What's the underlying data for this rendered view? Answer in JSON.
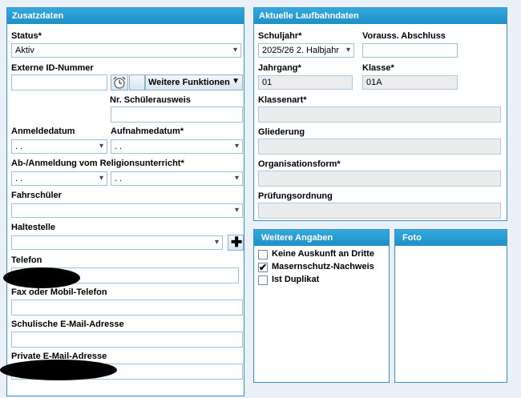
{
  "zusatz": {
    "title": "Zusatzdaten",
    "status_label": "Status*",
    "status_value": "Aktiv",
    "externe_id_label": "Externe ID-Nummer",
    "externe_id_value": "",
    "weitere_funktionen_label": "Weitere Funktionen",
    "schuelerausweis_label": "Nr. Schülerausweis",
    "anmeldedatum_label": "Anmeldedatum",
    "anmeldedatum_value": " .  .",
    "aufnahmedatum_label": "Aufnahmedatum*",
    "aufnahmedatum_value": " .  .",
    "religion_label": "Ab-/Anmeldung vom Religionsunterricht*",
    "religion_ab_value": " .  .",
    "religion_an_value": " .  .",
    "fahrschueler_label": "Fahrschüler",
    "haltestelle_label": "Haltestelle",
    "telefon_label": "Telefon",
    "fax_label": "Fax oder Mobil-Telefon",
    "schul_email_label": "Schulische E-Mail-Adresse",
    "privat_email_label": "Private E-Mail-Adresse"
  },
  "laufbahn": {
    "title": "Aktuelle Laufbahndaten",
    "schuljahr_label": "Schuljahr*",
    "schuljahr_value": "2025/26 2. Halbjahr",
    "abschluss_label": "Vorauss. Abschluss",
    "jahrgang_label": "Jahrgang*",
    "jahrgang_value": "01",
    "klasse_label": "Klasse*",
    "klasse_value": "01A",
    "klassenart_label": "Klassenart*",
    "gliederung_label": "Gliederung",
    "organisationsform_label": "Organisationsform*",
    "pruefungsordnung_label": "Prüfungsordnung"
  },
  "weitere": {
    "title": "Weitere Angaben",
    "items": [
      {
        "label": "Keine Auskunft an Dritte",
        "checked": false
      },
      {
        "label": "Masernschutz-Nachweis",
        "checked": true
      },
      {
        "label": "Ist Duplikat",
        "checked": false
      }
    ]
  },
  "foto": {
    "title": "Foto"
  }
}
